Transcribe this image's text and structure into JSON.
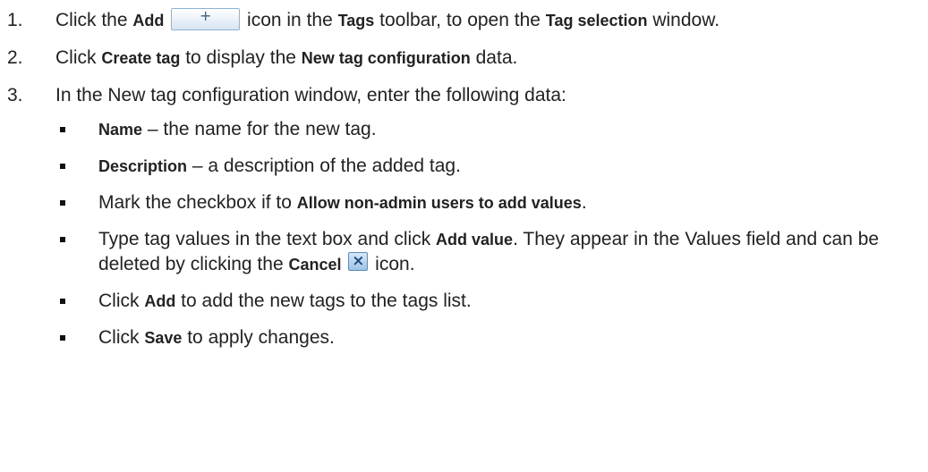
{
  "steps": [
    {
      "number": "1.",
      "t1": "Click the ",
      "b1": "Add",
      "add_icon_glyph": "+",
      "t2": " icon in the ",
      "b2": "Tags",
      "t3": " toolbar, to open the ",
      "b3": "Tag selection",
      "t4": " window."
    },
    {
      "number": "2.",
      "t1": "Click ",
      "b1": "Create tag",
      "t2": " to display the ",
      "b2": "New tag configuration",
      "t3": " data."
    },
    {
      "number": "3.",
      "t1": "In the New tag configuration window, enter the following data:"
    }
  ],
  "bullets": [
    {
      "b1": "Name",
      "t1": " – the name for the new tag."
    },
    {
      "b1": "Description",
      "t1": " – a description of the added tag."
    },
    {
      "t1": "Mark the checkbox if to ",
      "b1": "Allow non-admin users to add values",
      "t2": "."
    },
    {
      "t1": "Type tag values in the text box and click ",
      "b1": "Add value",
      "t2": ". They appear in the Values field and can be deleted by clicking the ",
      "b2": "Cancel",
      "cancel_icon_glyph": "×",
      "t3": " icon."
    },
    {
      "t1": "Click ",
      "b1": "Add",
      "t2": " to add the new tags to the tags list."
    },
    {
      "t1": "Click ",
      "b1": "Save",
      "t2": " to apply changes."
    }
  ],
  "icons": {
    "add": "plus-icon",
    "cancel": "cancel-x-icon",
    "bullet": "square-bullet"
  }
}
